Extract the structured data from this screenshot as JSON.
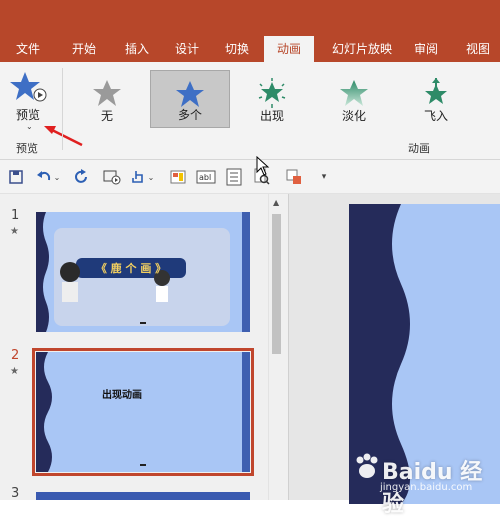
{
  "tabs": [
    "文件",
    "开始",
    "插入",
    "设计",
    "切换",
    "动画",
    "幻灯片放映",
    "审阅",
    "视图"
  ],
  "active_tab": "动画",
  "ribbon": {
    "preview_label": "预览",
    "preview_group_label": "预览",
    "animation_group_label": "动画",
    "animations": [
      {
        "label": "无",
        "icon": "star-gray-icon"
      },
      {
        "label": "多个",
        "icon": "star-blue-icon",
        "selected": true
      },
      {
        "label": "出现",
        "icon": "star-burst-icon"
      },
      {
        "label": "淡化",
        "icon": "star-fade-icon"
      },
      {
        "label": "飞入",
        "icon": "star-fly-icon"
      }
    ]
  },
  "slides": [
    {
      "number": "1",
      "star": "★",
      "title_art": "《 鹿 个 画 》",
      "selected": false
    },
    {
      "number": "2",
      "star": "★",
      "text": "出现动画",
      "selected": true
    },
    {
      "number": "3",
      "star": "",
      "selected": false
    }
  ],
  "watermark": {
    "brand": "Baidu 经验",
    "url": "jingyan.baidu.com"
  },
  "colors": {
    "accent": "#b7472a",
    "slide_bg": "#a9c6f5",
    "slide_dark": "#252b5a",
    "selected_border": "#c0462d"
  }
}
